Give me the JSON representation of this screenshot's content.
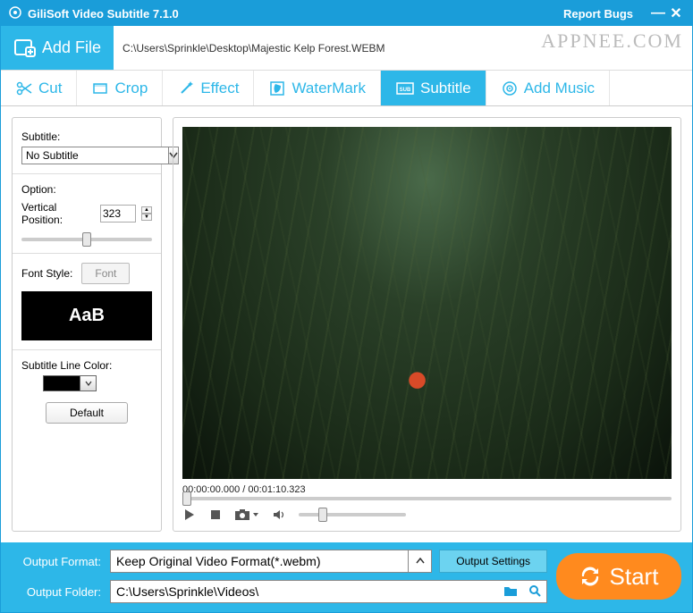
{
  "title": "GiliSoft Video Subtitle 7.1.0",
  "report_bugs": "Report Bugs",
  "watermark_text": "APPNEE.COM",
  "add_file_label": "Add File",
  "file_path": "C:\\Users\\Sprinkle\\Desktop\\Majestic Kelp Forest.WEBM",
  "tabs": {
    "cut": "Cut",
    "crop": "Crop",
    "effect": "Effect",
    "watermark": "WaterMark",
    "subtitle": "Subtitle",
    "addmusic": "Add Music"
  },
  "side": {
    "subtitle_label": "Subtitle:",
    "subtitle_value": "No Subtitle",
    "option_label": "Option:",
    "vpos_label": "Vertical Position:",
    "vpos_value": "323",
    "fontstyle_label": "Font Style:",
    "font_button": "Font",
    "preview_text": "AaB",
    "linecolor_label": "Subtitle Line Color:",
    "linecolor_value": "#000000",
    "default_button": "Default"
  },
  "player": {
    "time_current": "00:00:00.000",
    "time_total": "00:01:10.323"
  },
  "footer": {
    "format_label": "Output Format:",
    "format_value": "Keep Original Video Format(*.webm)",
    "output_settings": "Output Settings",
    "folder_label": "Output Folder:",
    "folder_value": "C:\\Users\\Sprinkle\\Videos\\",
    "start_label": "Start"
  }
}
